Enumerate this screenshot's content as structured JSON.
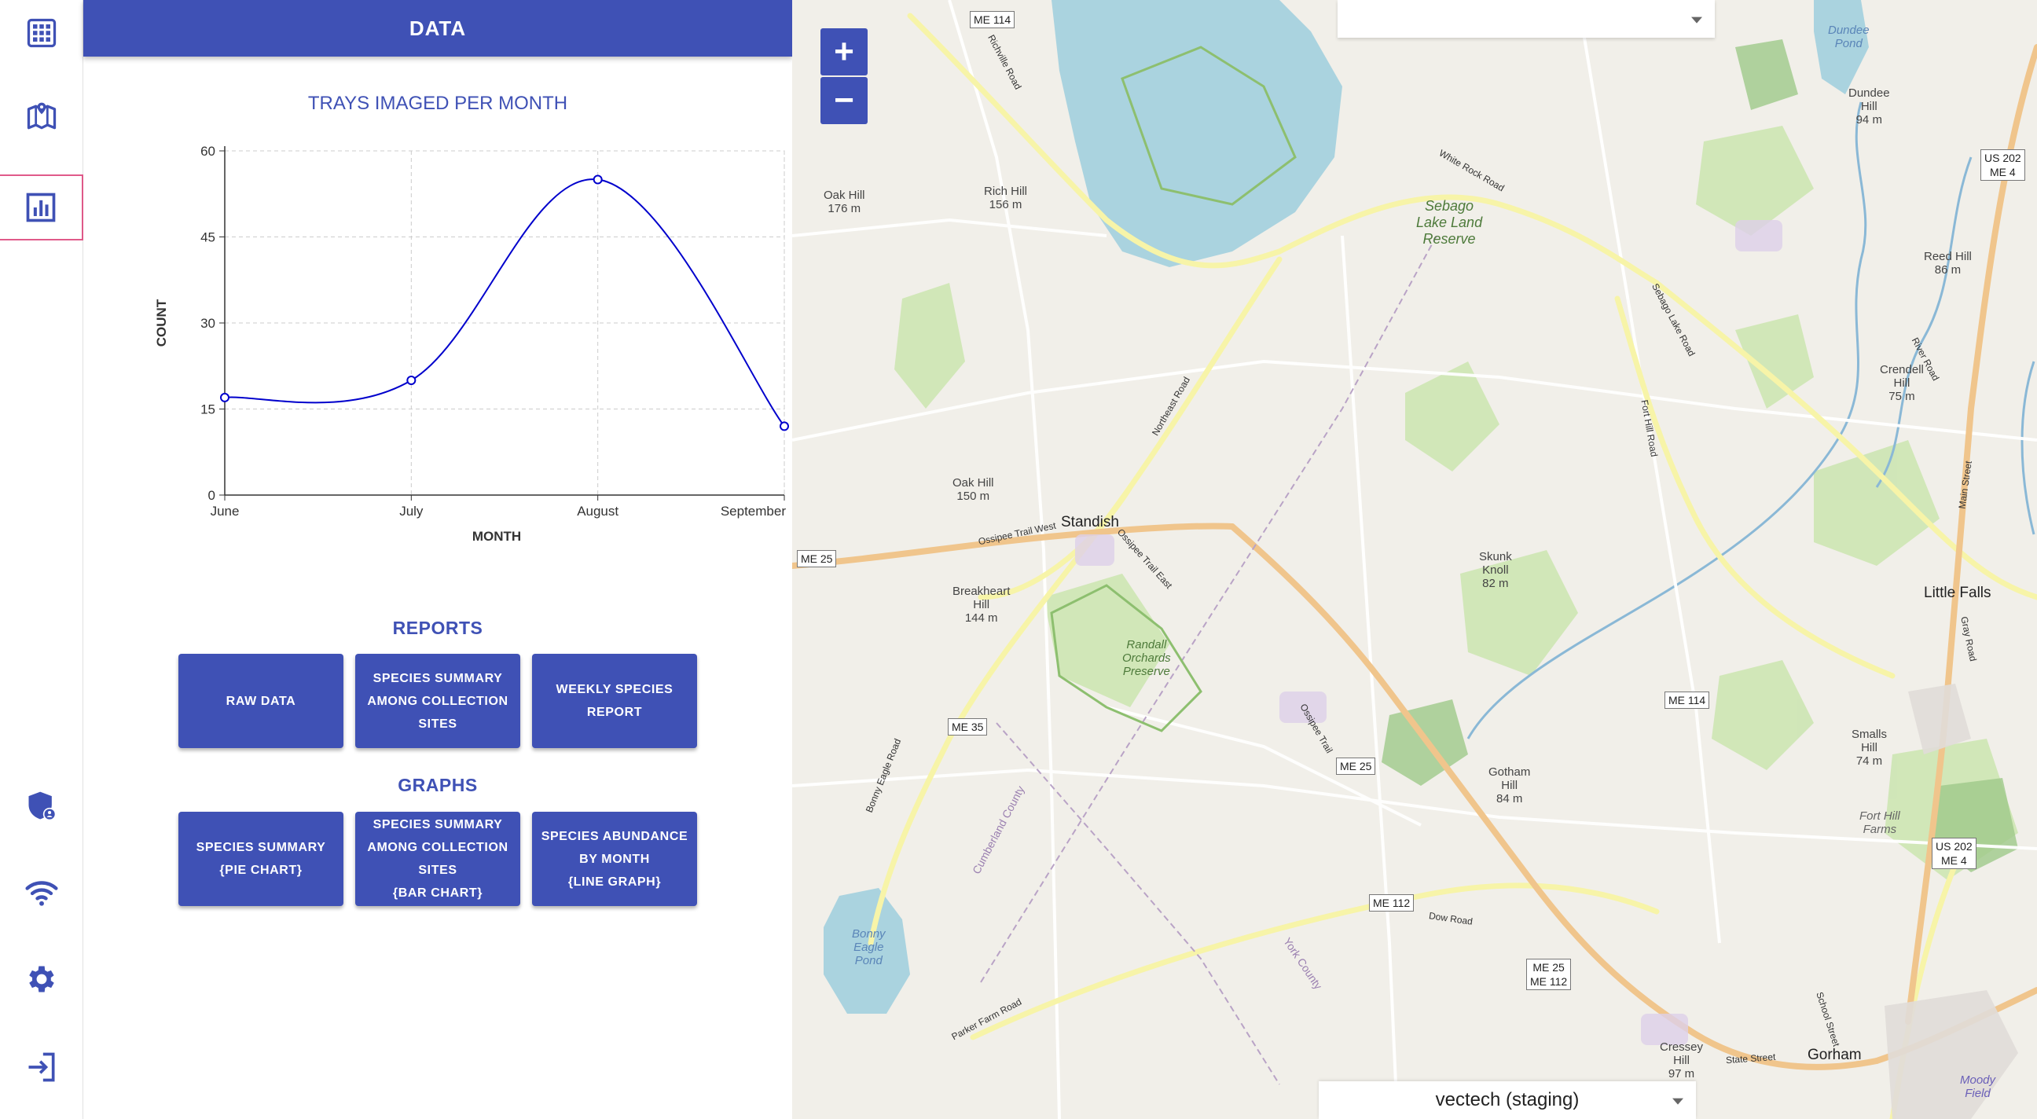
{
  "sidebar": {
    "items": [
      {
        "icon": "grid-icon"
      },
      {
        "icon": "map-icon"
      },
      {
        "icon": "bar-chart-icon",
        "active": true
      },
      {
        "icon": "shield-user-icon"
      },
      {
        "icon": "wifi-icon"
      },
      {
        "icon": "gear-icon"
      },
      {
        "icon": "login-icon"
      }
    ]
  },
  "panel": {
    "header": "DATA",
    "chart_title": "TRAYS IMAGED PER MONTH",
    "reports_title": "REPORTS",
    "graphs_title": "GRAPHS",
    "reports": [
      {
        "label": "RAW DATA"
      },
      {
        "label": "SPECIES SUMMARY\nAMONG COLLECTION\nSITES"
      },
      {
        "label": "WEEKLY SPECIES\nREPORT"
      }
    ],
    "graphs": [
      {
        "label": "SPECIES SUMMARY\n{PIE CHART}"
      },
      {
        "label": "SPECIES SUMMARY\nAMONG COLLECTION\nSITES\n{BAR CHART}"
      },
      {
        "label": "SPECIES ABUNDANCE\nBY MONTH\n{LINE GRAPH}"
      }
    ]
  },
  "chart_data": {
    "type": "line",
    "title": "TRAYS IMAGED PER MONTH",
    "xlabel": "MONTH",
    "ylabel": "COUNT",
    "categories": [
      "June",
      "July",
      "August",
      "September"
    ],
    "series": [
      {
        "values": [
          17,
          20,
          55,
          12
        ]
      }
    ],
    "ylim": [
      0,
      60
    ],
    "yticks": [
      0,
      15,
      30,
      45,
      60
    ],
    "grid": true,
    "color": "#0000cc"
  },
  "map": {
    "zoom_in": "+",
    "zoom_out": "−",
    "top_select_value": "",
    "env_select_value": "vectech (staging)",
    "places": [
      {
        "name": "Standish"
      },
      {
        "name": "Little Falls"
      },
      {
        "name": "Gorham"
      }
    ],
    "hills": [
      {
        "name": "Oak Hill\n176 m"
      },
      {
        "name": "Rich Hill\n156 m"
      },
      {
        "name": "Oak Hill\n150 m"
      },
      {
        "name": "Breakheart\nHill\n144 m"
      },
      {
        "name": "Skunk\nKnoll\n82 m"
      },
      {
        "name": "Gotham\nHill\n84 m"
      },
      {
        "name": "Dundee\nHill\n94 m"
      },
      {
        "name": "Reed Hill\n86 m"
      },
      {
        "name": "Crendell\nHill\n75 m"
      },
      {
        "name": "Smalls\nHill\n74 m"
      },
      {
        "name": "Cressey\nHill\n97 m"
      }
    ],
    "areas": [
      {
        "name": "Sebago\nLake Land\nReserve"
      },
      {
        "name": "Randall\nOrchards\nPreserve"
      },
      {
        "name": "Bonny\nEagle\nPond"
      },
      {
        "name": "Dundee\nPond"
      },
      {
        "name": "Fort Hill\nFarms"
      },
      {
        "name": "Moody\nField"
      }
    ],
    "shields": [
      {
        "label": "ME 114"
      },
      {
        "label": "ME 25"
      },
      {
        "label": "ME 35"
      },
      {
        "label": "ME 25"
      },
      {
        "label": "ME 112"
      },
      {
        "label": "ME 25\nME 112"
      },
      {
        "label": "ME 114"
      },
      {
        "label": "US 202\nME 4"
      },
      {
        "label": "US 202\nME 4"
      }
    ],
    "roads": [
      {
        "name": "Richville Road"
      },
      {
        "name": "White Rock Road"
      },
      {
        "name": "Northeast Road"
      },
      {
        "name": "Ossipee Trail West"
      },
      {
        "name": "Ossipee Trail East"
      },
      {
        "name": "Ossipee Trail"
      },
      {
        "name": "Fort Hill Road"
      },
      {
        "name": "Sebago Lake Road"
      },
      {
        "name": "Bonny Eagle Road"
      },
      {
        "name": "Parker Farm Road"
      },
      {
        "name": "Dow Road"
      },
      {
        "name": "River Road"
      },
      {
        "name": "Main Street"
      },
      {
        "name": "Gray Road"
      },
      {
        "name": "State Street"
      },
      {
        "name": "School Street"
      },
      {
        "name": "Cumberland County"
      },
      {
        "name": "York County"
      }
    ]
  }
}
